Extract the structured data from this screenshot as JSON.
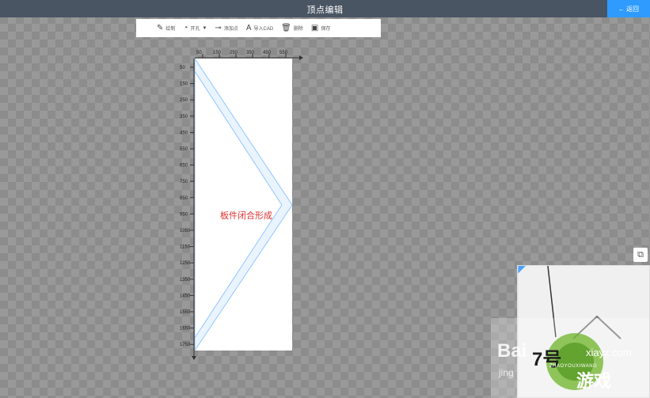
{
  "header": {
    "title": "顶点编辑",
    "back_label": "返回",
    "back_icon": "arrow-left-icon"
  },
  "toolbar": {
    "items": [
      {
        "label": "绘制",
        "icon": "draw-icon"
      },
      {
        "label": "开孔",
        "icon": "hole-icon",
        "has_dropdown": true
      },
      {
        "label": "添加点",
        "icon": "add-point-icon"
      },
      {
        "label": "导入CAD",
        "icon": "import-cad-icon"
      },
      {
        "label": "删除",
        "icon": "trash-icon"
      },
      {
        "label": "保存",
        "icon": "save-icon"
      }
    ]
  },
  "ruler": {
    "x_ticks": [
      "50",
      "150",
      "250",
      "350",
      "450",
      "550"
    ],
    "y_ticks": [
      "50",
      "150",
      "250",
      "350",
      "450",
      "550",
      "650",
      "750",
      "850",
      "950",
      "1050",
      "1150",
      "1250",
      "1350",
      "1450",
      "1550",
      "1650",
      "1750"
    ]
  },
  "canvas": {
    "board_label": "板件闭合形成",
    "label_color": "#e03030",
    "outline_color": "#4aa3ff"
  },
  "preview": {
    "toggle_icon": "layers-icon"
  },
  "watermarks": {
    "baidu_text": "Bai",
    "baidu_sub": "jing",
    "site_big": "7号",
    "site_domain": "xiayx.com",
    "site_sub": "ZHAOYOUXIWANG",
    "site_game": "游戏"
  },
  "colors": {
    "topbar": "#4a5563",
    "accent": "#2f9bff"
  }
}
